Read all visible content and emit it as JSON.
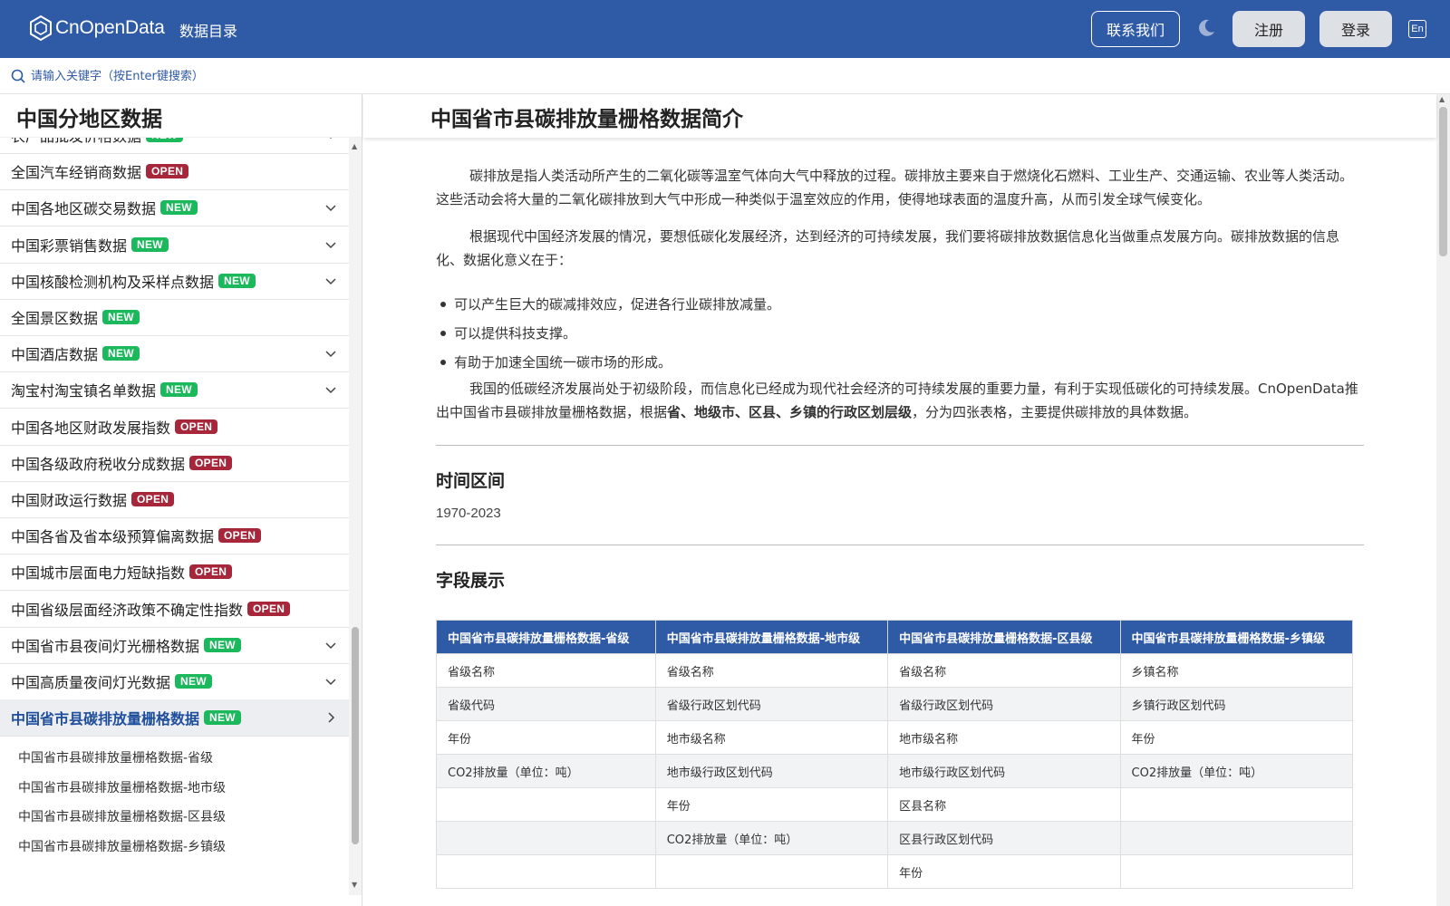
{
  "header": {
    "logo_text": "CnOpenData",
    "nav_catalog": "数据目录",
    "contact_label": "联系我们",
    "register_label": "注册",
    "login_label": "登录",
    "lang_label": "En",
    "brand_color": "#2f5ba6"
  },
  "search": {
    "placeholder": "请输入关键字（按Enter键搜索）"
  },
  "sidebar": {
    "title": "中国分地区数据",
    "items": [
      {
        "label": "农产品批发价格数据",
        "badge": "NEW",
        "chevron": true
      },
      {
        "label": "全国汽车经销商数据",
        "badge": "OPEN",
        "chevron": false
      },
      {
        "label": "中国各地区碳交易数据",
        "badge": "NEW",
        "chevron": true
      },
      {
        "label": "中国彩票销售数据",
        "badge": "NEW",
        "chevron": true
      },
      {
        "label": "中国核酸检测机构及采样点数据",
        "badge": "NEW",
        "chevron": true
      },
      {
        "label": "全国景区数据",
        "badge": "NEW",
        "chevron": false
      },
      {
        "label": "中国酒店数据",
        "badge": "NEW",
        "chevron": true
      },
      {
        "label": "淘宝村淘宝镇名单数据",
        "badge": "NEW",
        "chevron": true
      },
      {
        "label": "中国各地区财政发展指数",
        "badge": "OPEN",
        "chevron": false
      },
      {
        "label": "中国各级政府税收分成数据",
        "badge": "OPEN",
        "chevron": false
      },
      {
        "label": "中国财政运行数据",
        "badge": "OPEN",
        "chevron": false
      },
      {
        "label": "中国各省及省本级预算偏离数据",
        "badge": "OPEN",
        "chevron": false
      },
      {
        "label": "中国城市层面电力短缺指数",
        "badge": "OPEN",
        "chevron": false
      },
      {
        "label": "中国省级层面经济政策不确定性指数",
        "badge": "OPEN",
        "chevron": false
      },
      {
        "label": "中国省市县夜间灯光栅格数据",
        "badge": "NEW",
        "chevron": true
      },
      {
        "label": "中国高质量夜间灯光数据",
        "badge": "NEW",
        "chevron": true
      },
      {
        "label": "中国省市县碳排放量栅格数据",
        "badge": "NEW",
        "chevron": true,
        "active": true
      }
    ],
    "sub_items": [
      "中国省市县碳排放量栅格数据-省级",
      "中国省市县碳排放量栅格数据-地市级",
      "中国省市县碳排放量栅格数据-区县级",
      "中国省市县碳排放量栅格数据-乡镇级"
    ]
  },
  "main": {
    "title": "中国省市县碳排放量栅格数据简介",
    "para1": "碳排放是指人类活动所产生的二氧化碳等温室气体向大气中释放的过程。碳排放主要来自于燃烧化石燃料、工业生产、交通运输、农业等人类活动。这些活动会将大量的二氧化碳排放到大气中形成一种类似于温室效应的作用，使得地球表面的温度升高，从而引发全球气候变化。",
    "para2": "根据现代中国经济发展的情况，要想低碳化发展经济，达到经济的可持续发展，我们要将碳排放数据信息化当做重点发展方向。碳排放数据的信息化、数据化意义在于：",
    "bullets": [
      "可以产生巨大的碳减排效应，促进各行业碳排放减量。",
      "可以提供科技支撑。",
      "有助于加速全国统一碳市场的形成。"
    ],
    "para3_a": "我国的低碳经济发展尚处于初级阶段，而信息化已经成为现代社会经济的可持续发展的重要力量，有利于实现低碳化的可持续发展。CnOpenData推出中国省市县碳排放量栅格数据，根据",
    "para3_bold": "省、地级市、区县、乡镇的行政区划层级",
    "para3_b": "，分为四张表格，主要提供碳排放的具体数据。",
    "time_heading": "时间区间",
    "time_range": "1970-2023",
    "fields_heading": "字段展示",
    "table": {
      "headers": [
        "中国省市县碳排放量栅格数据-省级",
        "中国省市县碳排放量栅格数据-地市级",
        "中国省市县碳排放量栅格数据-区县级",
        "中国省市县碳排放量栅格数据-乡镇级"
      ],
      "rows": [
        [
          "省级名称",
          "省级名称",
          "省级名称",
          "乡镇名称"
        ],
        [
          "省级代码",
          "省级行政区划代码",
          "省级行政区划代码",
          "乡镇行政区划代码"
        ],
        [
          "年份",
          "地市级名称",
          "地市级名称",
          "年份"
        ],
        [
          "CO2排放量（单位：吨）",
          "地市级行政区划代码",
          "地市级行政区划代码",
          "CO2排放量（单位：吨）"
        ],
        [
          "",
          "年份",
          "区县名称",
          ""
        ],
        [
          "",
          "CO2排放量（单位：吨）",
          "区县行政区划代码",
          ""
        ],
        [
          "",
          "",
          "年份",
          ""
        ]
      ]
    }
  }
}
